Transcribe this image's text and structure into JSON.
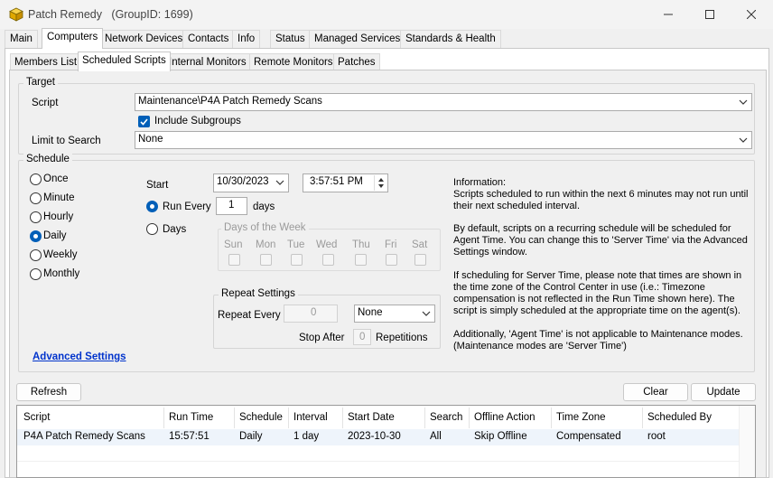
{
  "window": {
    "title": "Patch Remedy",
    "group_id": "(GroupID: 1699)"
  },
  "tabs": [
    "Main",
    "Computers",
    "Network Devices",
    "Contacts",
    "Info",
    "Status",
    "Managed Services",
    "Standards & Health"
  ],
  "subtabs": [
    "Members List",
    "Scheduled Scripts",
    "Internal Monitors",
    "Remote Monitors",
    "Patches"
  ],
  "target": {
    "legend": "Target",
    "script_label": "Script",
    "script_value": "Maintenance\\P4A Patch Remedy Scans",
    "include_subgroups": "Include Subgroups",
    "limit_label": "Limit to Search",
    "limit_value": "None"
  },
  "schedule": {
    "legend": "Schedule",
    "frequency": [
      "Once",
      "Minute",
      "Hourly",
      "Daily",
      "Weekly",
      "Monthly"
    ],
    "selected_frequency": "Daily",
    "start_label": "Start",
    "start_date": "10/30/2023",
    "start_time": "3:57:51 PM",
    "run_every_label": "Run Every",
    "run_every_value": "1",
    "days_unit": "days",
    "days_label": "Days",
    "dow_legend": "Days of the Week",
    "dow": [
      "Sun",
      "Mon",
      "Tue",
      "Wed",
      "Thu",
      "Fri",
      "Sat"
    ],
    "repeat_legend": "Repeat Settings",
    "repeat_every_label": "Repeat Every",
    "repeat_every_value": "0",
    "repeat_unit": "None",
    "stop_after_label": "Stop After",
    "stop_after_value": "0",
    "repetitions_label": "Repetitions",
    "advanced_settings": "Advanced Settings"
  },
  "info": {
    "p1": "Information:\nScripts scheduled to run within the next 6 minutes may not run until\ntheir next scheduled interval.",
    "p2": "By default, scripts on a recurring schedule will be scheduled for\nAgent Time. You can change this to 'Server Time' via the Advanced\nSettings window.",
    "p3": "If scheduling for Server Time, please note that times are shown in\nthe time zone of the Control Center in use (i.e.: Timezone\ncompensation is not reflected in the Run Time shown here). The\nscript is simply scheduled at the appropriate time on the agent(s).",
    "p4": "Additionally, 'Agent Time' is not applicable to Maintenance modes.\n(Maintenance modes are 'Server Time')"
  },
  "buttons": {
    "refresh": "Refresh",
    "clear": "Clear",
    "update": "Update"
  },
  "table": {
    "columns": [
      "Script",
      "Run Time",
      "Schedule",
      "Interval",
      "Start Date",
      "Search",
      "Offline Action",
      "Time Zone",
      "Scheduled By"
    ],
    "rows": [
      [
        "P4A Patch Remedy Scans",
        "15:57:51",
        "Daily",
        "1 day",
        "2023-10-30",
        "All",
        "Skip Offline",
        "Compensated",
        "root"
      ]
    ]
  },
  "colors": {
    "accent": "#005fb8",
    "link": "#0033cc",
    "selected_row": "#e5f1fb"
  }
}
